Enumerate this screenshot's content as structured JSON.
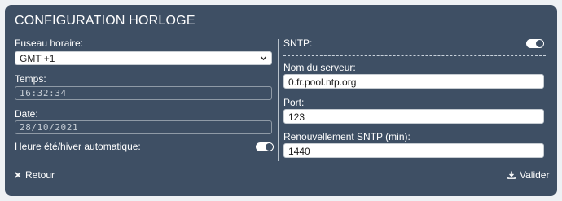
{
  "header": {
    "title": "CONFIGURATION HORLOGE"
  },
  "left": {
    "timezone": {
      "label": "Fuseau horaire:",
      "value": "GMT +1"
    },
    "time": {
      "label": "Temps:",
      "value": "16:32:34"
    },
    "date": {
      "label": "Date:",
      "value": "28/10/2021"
    },
    "dst": {
      "label": "Heure été/hiver automatique:",
      "enabled": true
    }
  },
  "right": {
    "sntp": {
      "label": "SNTP:",
      "enabled": true
    },
    "server": {
      "label": "Nom du serveur:",
      "value": "0.fr.pool.ntp.org"
    },
    "port": {
      "label": "Port:",
      "value": "123"
    },
    "refresh": {
      "label": "Renouvellement SNTP (min):",
      "value": "1440"
    }
  },
  "footer": {
    "back_label": "Retour",
    "validate_label": "Valider"
  },
  "colors": {
    "panel": "#3e4f64",
    "text": "#ffffff"
  },
  "icons": {
    "back": "close-icon",
    "validate": "download-icon",
    "select": "chevron-down-icon"
  }
}
